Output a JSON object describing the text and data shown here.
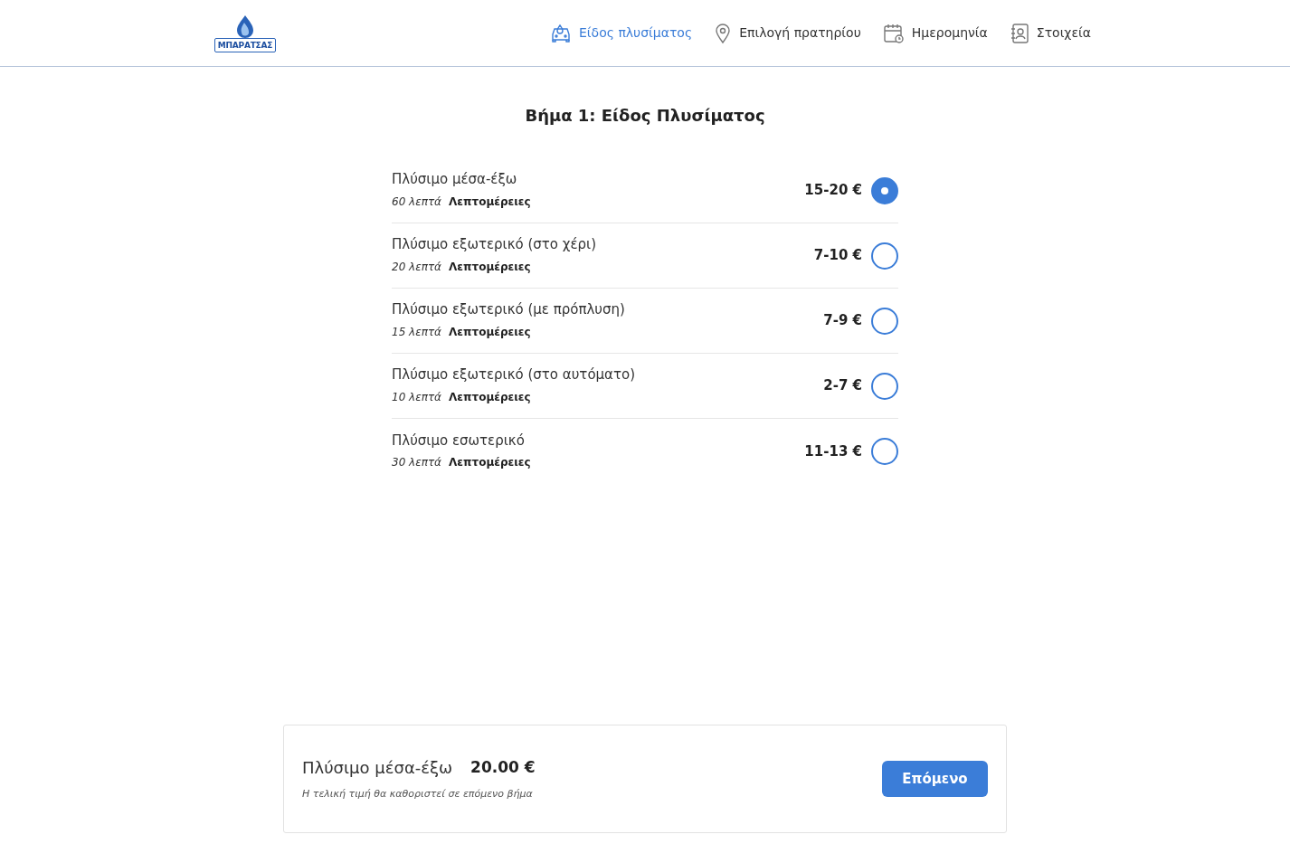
{
  "logo": {
    "text": "ΜΠΑΡΑΤΣΑΣ"
  },
  "steps": [
    {
      "kind": "car",
      "label": "Είδος πλυσίματος",
      "selected": true
    },
    {
      "kind": "pin",
      "label": "Επιλογή πρατηρίου",
      "selected": false
    },
    {
      "kind": "calendar",
      "label": "Ημερομηνία",
      "selected": false
    },
    {
      "kind": "contacts",
      "label": "Στοιχεία",
      "selected": false
    }
  ],
  "heading": "Βήμα 1: Είδος Πλυσίματος",
  "options": [
    {
      "name": "Πλύσιμο μέσα-έξω",
      "duration": "60 λεπτά",
      "details": "Λεπτομέρειες",
      "price": "15-20 €",
      "selected": true
    },
    {
      "name": "Πλύσιμο εξωτερικό (στο χέρι)",
      "duration": "20 λεπτά",
      "details": "Λεπτομέρειες",
      "price": "7-10 €",
      "selected": false
    },
    {
      "name": "Πλύσιμο εξωτερικό (με πρόπλυση)",
      "duration": "15 λεπτά",
      "details": "Λεπτομέρειες",
      "price": "7-9 €",
      "selected": false
    },
    {
      "name": "Πλύσιμο εξωτερικό (στο αυτόματο)",
      "duration": "10 λεπτά",
      "details": "Λεπτομέρειες",
      "price": "2-7 €",
      "selected": false
    },
    {
      "name": "Πλύσιμο εσωτερικό",
      "duration": "30 λεπτά",
      "details": "Λεπτομέρειες",
      "price": "11-13 €",
      "selected": false
    }
  ],
  "summary": {
    "name": "Πλύσιμο μέσα-έξω",
    "price": "20.00 €",
    "note": "Η τελική τιμή θα καθοριστεί σε επόμενο βήμα",
    "button": "Επόμενο"
  }
}
